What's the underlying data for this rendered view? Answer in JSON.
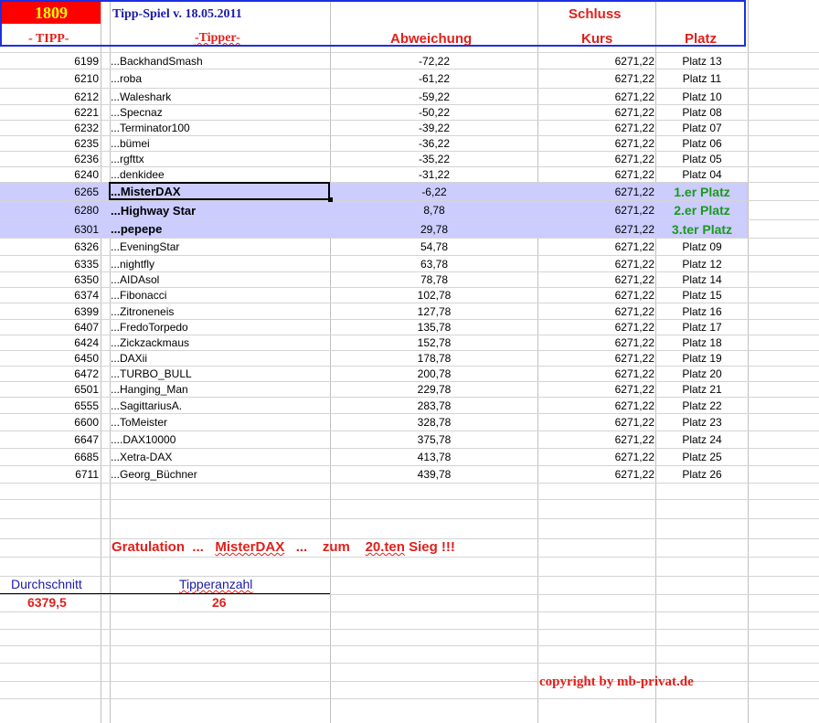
{
  "header": {
    "number": "1809",
    "title": "Tipp-Spiel v. 18.05.2011",
    "schluss": "Schluss",
    "tipp": "- TIPP-",
    "tipper": "-Tipper-",
    "abweichung": "Abweichung",
    "kurs": "Kurs",
    "platz": "Platz"
  },
  "rows": [
    {
      "tipp": "6199",
      "name": "...BackhandSmash",
      "abw": "-72,22",
      "kurs": "6271,22",
      "platz": "Platz 13"
    },
    {
      "tipp": "6210",
      "name": "...roba",
      "abw": "-61,22",
      "kurs": "6271,22",
      "platz": "Platz 11"
    },
    {
      "tipp": "6212",
      "name": "...Waleshark",
      "abw": "-59,22",
      "kurs": "6271,22",
      "platz": "Platz 10"
    },
    {
      "tipp": "6221",
      "name": "...Specnaz",
      "abw": "-50,22",
      "kurs": "6271,22",
      "platz": "Platz 08"
    },
    {
      "tipp": "6232",
      "name": "...Terminator100",
      "abw": "-39,22",
      "kurs": "6271,22",
      "platz": "Platz 07"
    },
    {
      "tipp": "6235",
      "name": "...bümei",
      "abw": "-36,22",
      "kurs": "6271,22",
      "platz": "Platz 06"
    },
    {
      "tipp": "6236",
      "name": "...rgfttx",
      "abw": "-35,22",
      "kurs": "6271,22",
      "platz": "Platz 05"
    },
    {
      "tipp": "6240",
      "name": "...denkidee",
      "abw": "-31,22",
      "kurs": "6271,22",
      "platz": "Platz 04"
    },
    {
      "tipp": "6265",
      "name": "...MisterDAX",
      "abw": "-6,22",
      "kurs": "6271,22",
      "platz": "1.er Platz"
    },
    {
      "tipp": "6280",
      "name": "...Highway Star",
      "abw": "8,78",
      "kurs": "6271,22",
      "platz": "2.er Platz"
    },
    {
      "tipp": "6301",
      "name": "...pepepe",
      "abw": "29,78",
      "kurs": "6271,22",
      "platz": "3.ter Platz"
    },
    {
      "tipp": "6326",
      "name": "...EveningStar",
      "abw": "54,78",
      "kurs": "6271,22",
      "platz": "Platz 09"
    },
    {
      "tipp": "6335",
      "name": "...nightfly",
      "abw": "63,78",
      "kurs": "6271,22",
      "platz": "Platz 12"
    },
    {
      "tipp": "6350",
      "name": "...AIDAsol",
      "abw": "78,78",
      "kurs": "6271,22",
      "platz": "Platz 14"
    },
    {
      "tipp": "6374",
      "name": "...Fibonacci",
      "abw": "102,78",
      "kurs": "6271,22",
      "platz": "Platz 15"
    },
    {
      "tipp": "6399",
      "name": "...Zitroneneis",
      "abw": "127,78",
      "kurs": "6271,22",
      "platz": "Platz 16"
    },
    {
      "tipp": "6407",
      "name": "...FredoTorpedo",
      "abw": "135,78",
      "kurs": "6271,22",
      "platz": "Platz 17"
    },
    {
      "tipp": "6424",
      "name": "...Zickzackmaus",
      "abw": "152,78",
      "kurs": "6271,22",
      "platz": "Platz 18"
    },
    {
      "tipp": "6450",
      "name": "...DAXii",
      "abw": "178,78",
      "kurs": "6271,22",
      "platz": "Platz 19"
    },
    {
      "tipp": "6472",
      "name": "...TURBO_BULL",
      "abw": "200,78",
      "kurs": "6271,22",
      "platz": "Platz 20"
    },
    {
      "tipp": "6501",
      "name": "...Hanging_Man",
      "abw": "229,78",
      "kurs": "6271,22",
      "platz": "Platz 21"
    },
    {
      "tipp": "6555",
      "name": "...SagittariusA.",
      "abw": "283,78",
      "kurs": "6271,22",
      "platz": "Platz 22"
    },
    {
      "tipp": "6600",
      "name": "...ToMeister",
      "abw": "328,78",
      "kurs": "6271,22",
      "platz": "Platz 23"
    },
    {
      "tipp": "6647",
      "name": "....DAX10000",
      "abw": "375,78",
      "kurs": "6271,22",
      "platz": "Platz 24"
    },
    {
      "tipp": "6685",
      "name": "...Xetra-DAX",
      "abw": "413,78",
      "kurs": "6271,22",
      "platz": "Platz 25"
    },
    {
      "tipp": "6711",
      "name": "...Georg_Büchner",
      "abw": "439,78",
      "kurs": "6271,22",
      "platz": "Platz 26"
    }
  ],
  "footer": {
    "gratulation_pre": "Gratulation  ...   ",
    "gratulation_name": "MisterDAX",
    "gratulation_mid": "   ...    zum    ",
    "gratulation_sieg": "20.ten",
    "gratulation_post": " Sieg !!!",
    "durchschnitt_label": "Durchschnitt",
    "tipperanzahl_label": "Tipperanzahl",
    "durchschnitt_value": "6379,5",
    "tipperanzahl_value": "26",
    "copyright": "copyright by mb-privat.de"
  },
  "colors": {
    "accent_red": "#e0201b",
    "header_blue": "#1a1aa8",
    "highlight": "#ccccff",
    "podium_green": "#1a9a1a"
  }
}
